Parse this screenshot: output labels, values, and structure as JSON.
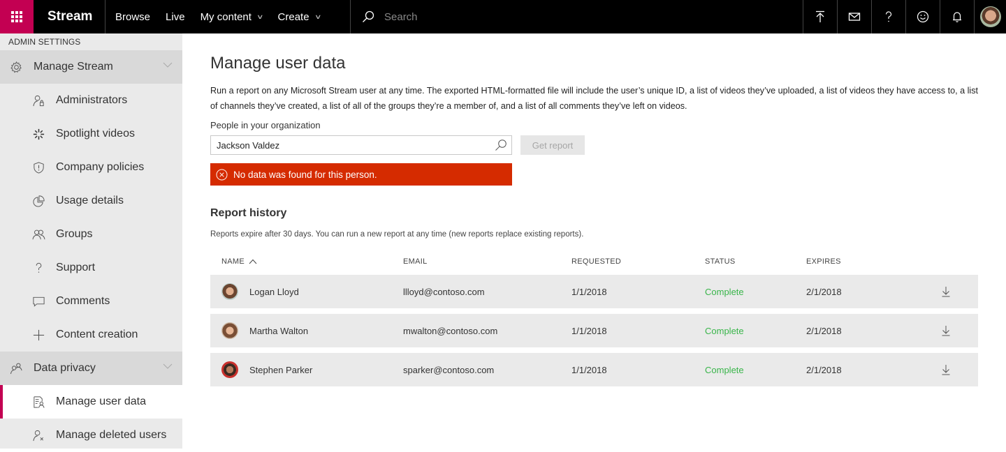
{
  "app": {
    "brand": "Stream",
    "brand_color": "#c30052"
  },
  "topnav": {
    "items": [
      {
        "label": "Browse",
        "has_dropdown": false
      },
      {
        "label": "Live",
        "has_dropdown": false
      },
      {
        "label": "My content",
        "has_dropdown": true
      },
      {
        "label": "Create",
        "has_dropdown": true
      }
    ],
    "search_placeholder": "Search",
    "icons": [
      "upload-icon",
      "mail-icon",
      "help-icon",
      "feedback-smiley-icon",
      "notifications-bell-icon",
      "user-avatar"
    ]
  },
  "sidebar": {
    "heading": "ADMIN SETTINGS",
    "groups": [
      {
        "label": "Manage Stream",
        "icon": "gear-icon",
        "items": [
          {
            "label": "Administrators",
            "icon": "admin-person-icon"
          },
          {
            "label": "Spotlight videos",
            "icon": "spotlight-icon"
          },
          {
            "label": "Company policies",
            "icon": "shield-icon"
          },
          {
            "label": "Usage details",
            "icon": "pie-chart-icon"
          },
          {
            "label": "Groups",
            "icon": "groups-icon"
          },
          {
            "label": "Support",
            "icon": "question-icon"
          },
          {
            "label": "Comments",
            "icon": "comment-icon"
          },
          {
            "label": "Content creation",
            "icon": "plus-icon"
          }
        ]
      },
      {
        "label": "Data privacy",
        "icon": "people-icon",
        "items": [
          {
            "label": "Manage user data",
            "icon": "user-data-icon",
            "active": true
          },
          {
            "label": "Manage deleted users",
            "icon": "deleted-user-icon"
          }
        ]
      }
    ]
  },
  "main": {
    "title": "Manage user data",
    "description": "Run a report on any Microsoft Stream user at any time. The exported HTML-formatted file will include the user’s unique ID, a list of videos they’ve uploaded, a list of videos they have access to, a list of channels they’ve created, a list of all of the groups they’re a member of, and a list of all comments they’ve left on videos.",
    "people_label": "People in your organization",
    "people_value": "Jackson Valdez",
    "get_report_label": "Get report",
    "error_message": "No data was found for this person.",
    "error_color": "#d52b00",
    "report_history": {
      "title": "Report history",
      "note": "Reports expire after 30 days. You can run a new report at any time (new reports replace existing reports).",
      "columns": [
        "NAME",
        "EMAIL",
        "REQUESTED",
        "STATUS",
        "EXPIRES"
      ],
      "sort_column": "NAME",
      "sort_direction": "ascending",
      "status_color": "#39b54a",
      "rows": [
        {
          "name": "Logan Lloyd",
          "email": "llloyd@contoso.com",
          "requested": "1/1/2018",
          "status": "Complete",
          "expires": "2/1/2018"
        },
        {
          "name": "Martha Walton",
          "email": "mwalton@contoso.com",
          "requested": "1/1/2018",
          "status": "Complete",
          "expires": "2/1/2018"
        },
        {
          "name": "Stephen Parker",
          "email": "sparker@contoso.com",
          "requested": "1/1/2018",
          "status": "Complete",
          "expires": "2/1/2018"
        }
      ]
    }
  }
}
